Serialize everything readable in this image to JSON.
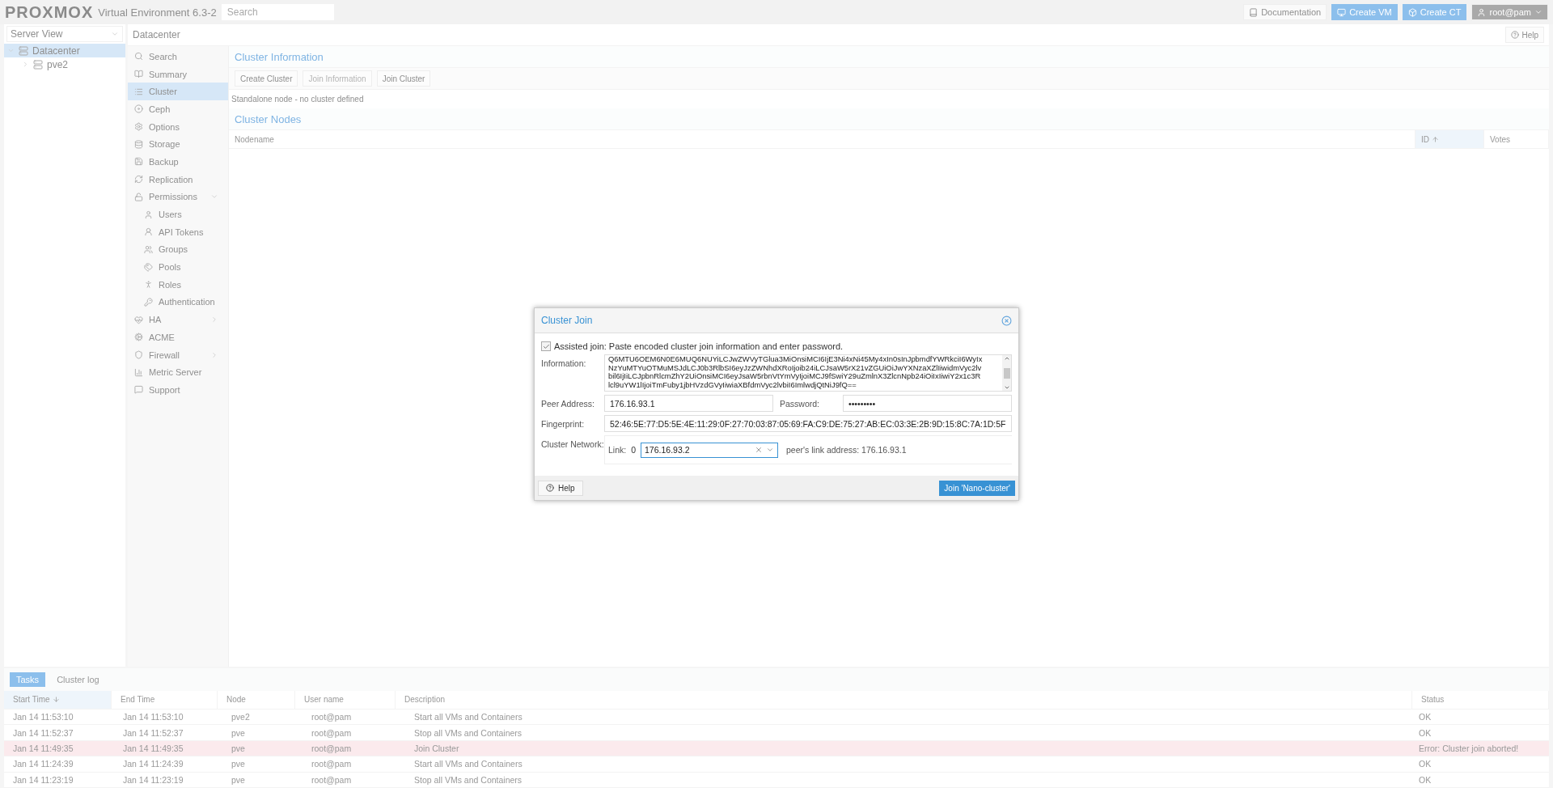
{
  "topbar": {
    "logo": "PROXMOX",
    "version": "Virtual Environment 6.3-2",
    "search": {
      "placeholder": "Search"
    },
    "buttons": [
      {
        "kind": "doc",
        "label": "Documentation"
      },
      {
        "kind": "primary",
        "label": "Create VM"
      },
      {
        "kind": "primary",
        "label": "Create CT"
      },
      {
        "kind": "user",
        "label": "root@pam"
      }
    ]
  },
  "tree": {
    "view": "Server View",
    "items": [
      {
        "label": "Datacenter",
        "selected": true,
        "expanded": true,
        "children": [
          {
            "label": "pve2",
            "selected": false,
            "expanded": false
          }
        ]
      }
    ]
  },
  "breadcrumb": "Datacenter",
  "help": "Help",
  "nav": [
    {
      "label": "Search",
      "selected": false
    },
    {
      "label": "Summary",
      "selected": false
    },
    {
      "label": "Cluster",
      "selected": true
    },
    {
      "label": "Ceph",
      "selected": false
    },
    {
      "label": "Options",
      "selected": false
    },
    {
      "label": "Storage",
      "selected": false
    },
    {
      "label": "Backup",
      "selected": false
    },
    {
      "label": "Replication",
      "selected": false
    },
    {
      "label": "Permissions",
      "selected": false,
      "expanded": true,
      "children": [
        {
          "label": "Users",
          "selected": false
        },
        {
          "label": "API Tokens",
          "selected": false
        },
        {
          "label": "Groups",
          "selected": false
        },
        {
          "label": "Pools",
          "selected": false
        },
        {
          "label": "Roles",
          "selected": false
        },
        {
          "label": "Authentication",
          "selected": false
        }
      ]
    },
    {
      "label": "HA",
      "selected": false,
      "expanded": false
    },
    {
      "label": "ACME",
      "selected": false
    },
    {
      "label": "Firewall",
      "selected": false,
      "expanded": false
    },
    {
      "label": "Metric Server",
      "selected": false
    },
    {
      "label": "Support",
      "selected": false
    }
  ],
  "cluster_information": {
    "title": "Cluster Information",
    "buttons": [
      {
        "label": "Create Cluster",
        "disabled": false
      },
      {
        "label": "Join Information",
        "disabled": true
      },
      {
        "label": "Join Cluster",
        "disabled": false
      }
    ],
    "status": "Standalone node - no cluster defined"
  },
  "cluster_nodes": {
    "title": "Cluster Nodes",
    "columns": [
      {
        "label": "Nodename",
        "sorted": false
      },
      {
        "label": "ID",
        "sorted": true
      },
      {
        "label": "Votes",
        "sorted": false
      }
    ]
  },
  "dialog": {
    "title": "Cluster Join",
    "assisted": {
      "label": "Assisted join: Paste encoded cluster join information and enter password.",
      "checked": true
    },
    "information": {
      "label": "Information:",
      "lines": [
        "Q6MTU6OEM6N0E6MUQ6NUYiLCJwZWVyTGlua3MiOnsiMCI6IjE3Ni4xNi45My4xIn0sInJpbmdfYWRkciI6WyIx",
        "NzYuMTYuOTMuMSJdLCJ0b3RlbSI6eyJzZWNhdXRoIjoib24iLCJsaW5rX21vZGUiOiJwYXNzaXZlIiwidmVyc2lv",
        "bil6IjIiLCJpbnRlcmZhY2UiOnsiMCI6eyJsaW5rbnVtYmVyIjoiMCJ9fSwiY29uZmlnX3ZlcnNpb24iOiIxIiwiY2x1c3R",
        "lcl9uYW1lIjoiTmFuby1jbHVzdGVyIiwiaXBfdmVyc2lvbiI6ImlwdjQtNiJ9fQ=="
      ]
    },
    "peer_address": {
      "label": "Peer Address:",
      "value": "176.16.93.1"
    },
    "password": {
      "label": "Password:",
      "value": "•••••••••"
    },
    "fingerprint": {
      "label": "Fingerprint:",
      "value": "52:46:5E:77:D5:5E:4E:11:29:0F:27:70:03:87:05:69:FA:C9:DE:75:27:AB:EC:03:3E:2B:9D:15:8C:7A:1D:5F"
    },
    "cluster_network": {
      "label": "Cluster Network:",
      "link_label": "Link:",
      "link_number": "0",
      "value": "176.16.93.2",
      "peer_link": "peer's link address: 176.16.93.1"
    },
    "help": "Help",
    "join": "Join 'Nano-cluster'"
  },
  "tasks": {
    "tabs": [
      {
        "label": "Tasks",
        "selected": true
      },
      {
        "label": "Cluster log",
        "selected": false
      }
    ],
    "columns": [
      {
        "label": "Start Time",
        "sorted": true
      },
      {
        "label": "End Time",
        "sorted": false
      },
      {
        "label": "Node",
        "sorted": false
      },
      {
        "label": "User name",
        "sorted": false
      },
      {
        "label": "Description",
        "sorted": false
      },
      {
        "label": "Status",
        "sorted": false
      }
    ],
    "rows": [
      {
        "cells": [
          "Jan 14 11:53:10",
          "Jan 14 11:53:10",
          "pve2",
          "root@pam",
          "Start all VMs and Containers",
          "OK"
        ],
        "error": false
      },
      {
        "cells": [
          "Jan 14 11:52:37",
          "Jan 14 11:52:37",
          "pve",
          "root@pam",
          "Stop all VMs and Containers",
          "OK"
        ],
        "error": false
      },
      {
        "cells": [
          "Jan 14 11:49:35",
          "Jan 14 11:49:35",
          "pve",
          "root@pam",
          "Join Cluster",
          "Error: Cluster join aborted!"
        ],
        "error": true
      },
      {
        "cells": [
          "Jan 14 11:24:39",
          "Jan 14 11:24:39",
          "pve",
          "root@pam",
          "Start all VMs and Containers",
          "OK"
        ],
        "error": false
      },
      {
        "cells": [
          "Jan 14 11:23:19",
          "Jan 14 11:23:19",
          "pve",
          "root@pam",
          "Stop all VMs and Containers",
          "OK"
        ],
        "error": false
      }
    ]
  }
}
